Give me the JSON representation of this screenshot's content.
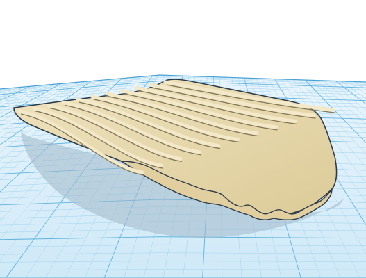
{
  "viewport": {
    "background": "#ffffff",
    "grid": {
      "plane_color": "#cfe9f7",
      "minor_line_color": "#9fd3ef",
      "major_line_color": "#5fb3e0",
      "edge_color": "#4aa3d6"
    }
  },
  "model": {
    "name": "ridged-shell-shape",
    "fill_color": "#e6d7ad",
    "highlight_color": "#f3e8c8",
    "groove_color": "#7f7758",
    "outline_color": "#2d3a4a",
    "shadow_color": "#9fb8c8",
    "ridges": 11
  }
}
